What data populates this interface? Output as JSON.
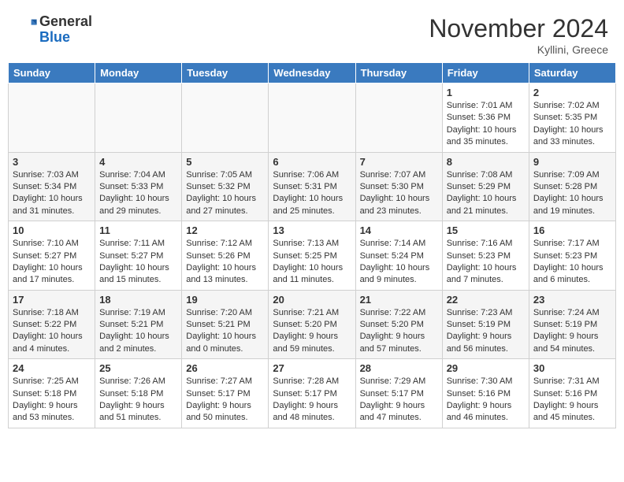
{
  "header": {
    "logo_general": "General",
    "logo_blue": "Blue",
    "month_year": "November 2024",
    "location": "Kyllini, Greece"
  },
  "weekdays": [
    "Sunday",
    "Monday",
    "Tuesday",
    "Wednesday",
    "Thursday",
    "Friday",
    "Saturday"
  ],
  "weeks": [
    [
      {
        "day": "",
        "sunrise": "",
        "sunset": "",
        "daylight": ""
      },
      {
        "day": "",
        "sunrise": "",
        "sunset": "",
        "daylight": ""
      },
      {
        "day": "",
        "sunrise": "",
        "sunset": "",
        "daylight": ""
      },
      {
        "day": "",
        "sunrise": "",
        "sunset": "",
        "daylight": ""
      },
      {
        "day": "",
        "sunrise": "",
        "sunset": "",
        "daylight": ""
      },
      {
        "day": "1",
        "sunrise": "Sunrise: 7:01 AM",
        "sunset": "Sunset: 5:36 PM",
        "daylight": "Daylight: 10 hours and 35 minutes."
      },
      {
        "day": "2",
        "sunrise": "Sunrise: 7:02 AM",
        "sunset": "Sunset: 5:35 PM",
        "daylight": "Daylight: 10 hours and 33 minutes."
      }
    ],
    [
      {
        "day": "3",
        "sunrise": "Sunrise: 7:03 AM",
        "sunset": "Sunset: 5:34 PM",
        "daylight": "Daylight: 10 hours and 31 minutes."
      },
      {
        "day": "4",
        "sunrise": "Sunrise: 7:04 AM",
        "sunset": "Sunset: 5:33 PM",
        "daylight": "Daylight: 10 hours and 29 minutes."
      },
      {
        "day": "5",
        "sunrise": "Sunrise: 7:05 AM",
        "sunset": "Sunset: 5:32 PM",
        "daylight": "Daylight: 10 hours and 27 minutes."
      },
      {
        "day": "6",
        "sunrise": "Sunrise: 7:06 AM",
        "sunset": "Sunset: 5:31 PM",
        "daylight": "Daylight: 10 hours and 25 minutes."
      },
      {
        "day": "7",
        "sunrise": "Sunrise: 7:07 AM",
        "sunset": "Sunset: 5:30 PM",
        "daylight": "Daylight: 10 hours and 23 minutes."
      },
      {
        "day": "8",
        "sunrise": "Sunrise: 7:08 AM",
        "sunset": "Sunset: 5:29 PM",
        "daylight": "Daylight: 10 hours and 21 minutes."
      },
      {
        "day": "9",
        "sunrise": "Sunrise: 7:09 AM",
        "sunset": "Sunset: 5:28 PM",
        "daylight": "Daylight: 10 hours and 19 minutes."
      }
    ],
    [
      {
        "day": "10",
        "sunrise": "Sunrise: 7:10 AM",
        "sunset": "Sunset: 5:27 PM",
        "daylight": "Daylight: 10 hours and 17 minutes."
      },
      {
        "day": "11",
        "sunrise": "Sunrise: 7:11 AM",
        "sunset": "Sunset: 5:27 PM",
        "daylight": "Daylight: 10 hours and 15 minutes."
      },
      {
        "day": "12",
        "sunrise": "Sunrise: 7:12 AM",
        "sunset": "Sunset: 5:26 PM",
        "daylight": "Daylight: 10 hours and 13 minutes."
      },
      {
        "day": "13",
        "sunrise": "Sunrise: 7:13 AM",
        "sunset": "Sunset: 5:25 PM",
        "daylight": "Daylight: 10 hours and 11 minutes."
      },
      {
        "day": "14",
        "sunrise": "Sunrise: 7:14 AM",
        "sunset": "Sunset: 5:24 PM",
        "daylight": "Daylight: 10 hours and 9 minutes."
      },
      {
        "day": "15",
        "sunrise": "Sunrise: 7:16 AM",
        "sunset": "Sunset: 5:23 PM",
        "daylight": "Daylight: 10 hours and 7 minutes."
      },
      {
        "day": "16",
        "sunrise": "Sunrise: 7:17 AM",
        "sunset": "Sunset: 5:23 PM",
        "daylight": "Daylight: 10 hours and 6 minutes."
      }
    ],
    [
      {
        "day": "17",
        "sunrise": "Sunrise: 7:18 AM",
        "sunset": "Sunset: 5:22 PM",
        "daylight": "Daylight: 10 hours and 4 minutes."
      },
      {
        "day": "18",
        "sunrise": "Sunrise: 7:19 AM",
        "sunset": "Sunset: 5:21 PM",
        "daylight": "Daylight: 10 hours and 2 minutes."
      },
      {
        "day": "19",
        "sunrise": "Sunrise: 7:20 AM",
        "sunset": "Sunset: 5:21 PM",
        "daylight": "Daylight: 10 hours and 0 minutes."
      },
      {
        "day": "20",
        "sunrise": "Sunrise: 7:21 AM",
        "sunset": "Sunset: 5:20 PM",
        "daylight": "Daylight: 9 hours and 59 minutes."
      },
      {
        "day": "21",
        "sunrise": "Sunrise: 7:22 AM",
        "sunset": "Sunset: 5:20 PM",
        "daylight": "Daylight: 9 hours and 57 minutes."
      },
      {
        "day": "22",
        "sunrise": "Sunrise: 7:23 AM",
        "sunset": "Sunset: 5:19 PM",
        "daylight": "Daylight: 9 hours and 56 minutes."
      },
      {
        "day": "23",
        "sunrise": "Sunrise: 7:24 AM",
        "sunset": "Sunset: 5:19 PM",
        "daylight": "Daylight: 9 hours and 54 minutes."
      }
    ],
    [
      {
        "day": "24",
        "sunrise": "Sunrise: 7:25 AM",
        "sunset": "Sunset: 5:18 PM",
        "daylight": "Daylight: 9 hours and 53 minutes."
      },
      {
        "day": "25",
        "sunrise": "Sunrise: 7:26 AM",
        "sunset": "Sunset: 5:18 PM",
        "daylight": "Daylight: 9 hours and 51 minutes."
      },
      {
        "day": "26",
        "sunrise": "Sunrise: 7:27 AM",
        "sunset": "Sunset: 5:17 PM",
        "daylight": "Daylight: 9 hours and 50 minutes."
      },
      {
        "day": "27",
        "sunrise": "Sunrise: 7:28 AM",
        "sunset": "Sunset: 5:17 PM",
        "daylight": "Daylight: 9 hours and 48 minutes."
      },
      {
        "day": "28",
        "sunrise": "Sunrise: 7:29 AM",
        "sunset": "Sunset: 5:17 PM",
        "daylight": "Daylight: 9 hours and 47 minutes."
      },
      {
        "day": "29",
        "sunrise": "Sunrise: 7:30 AM",
        "sunset": "Sunset: 5:16 PM",
        "daylight": "Daylight: 9 hours and 46 minutes."
      },
      {
        "day": "30",
        "sunrise": "Sunrise: 7:31 AM",
        "sunset": "Sunset: 5:16 PM",
        "daylight": "Daylight: 9 hours and 45 minutes."
      }
    ]
  ]
}
